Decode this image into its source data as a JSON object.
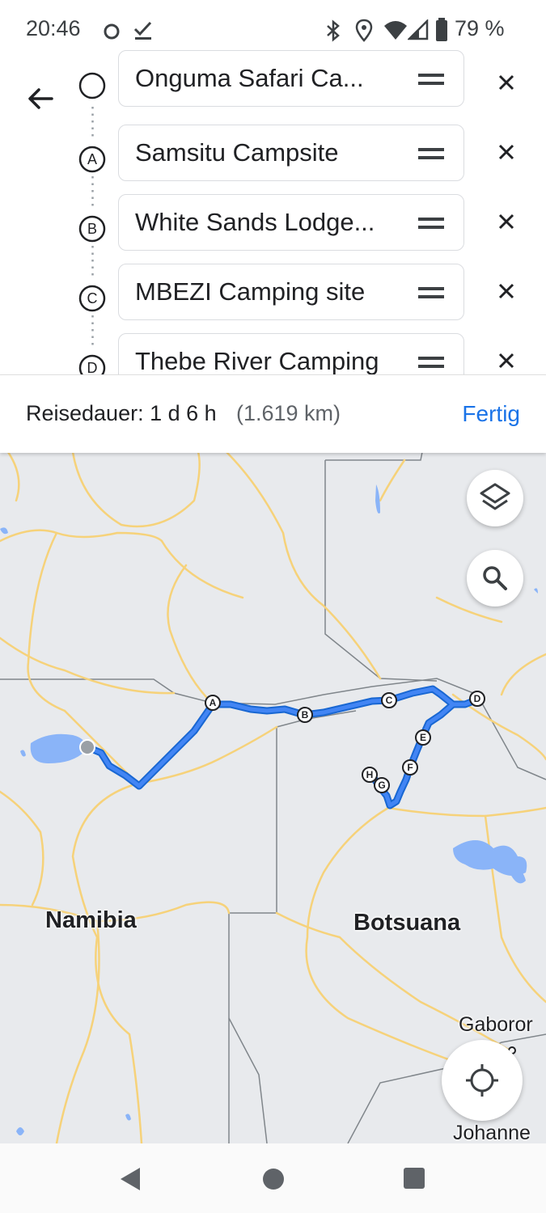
{
  "status_bar": {
    "time": "20:46",
    "battery_percent": "79 %",
    "icons": [
      "notification-circle-icon",
      "check-icon",
      "bluetooth-icon",
      "location-icon",
      "wifi-icon",
      "signal-icon",
      "battery-icon"
    ]
  },
  "route_editor": {
    "back_icon": "arrow-back-icon",
    "stops": [
      {
        "marker": "",
        "label": "Onguma Safari Ca..."
      },
      {
        "marker": "A",
        "label": "Samsitu Campsite"
      },
      {
        "marker": "B",
        "label": "White Sands Lodge..."
      },
      {
        "marker": "C",
        "label": "MBEZI Camping site"
      },
      {
        "marker": "D",
        "label": "Thebe River Camping"
      }
    ]
  },
  "summary": {
    "duration": "Reisedauer: 1 d 6 h",
    "distance": "(1.619 km)",
    "done_label": "Fertig"
  },
  "map": {
    "countries": [
      "Namibia",
      "Botsuana"
    ],
    "cities": [
      "Gaboror",
      "Johanne"
    ],
    "waypoints": [
      "A",
      "B",
      "C",
      "D",
      "E",
      "F",
      "G",
      "H"
    ],
    "route_color": "#4285f4",
    "water_color": "#8ab4f8",
    "road_color": "#f6d27a",
    "border_color": "#80868b"
  },
  "navigation": {
    "icons": [
      "back-triangle-icon",
      "home-circle-icon",
      "recents-square-icon"
    ]
  }
}
